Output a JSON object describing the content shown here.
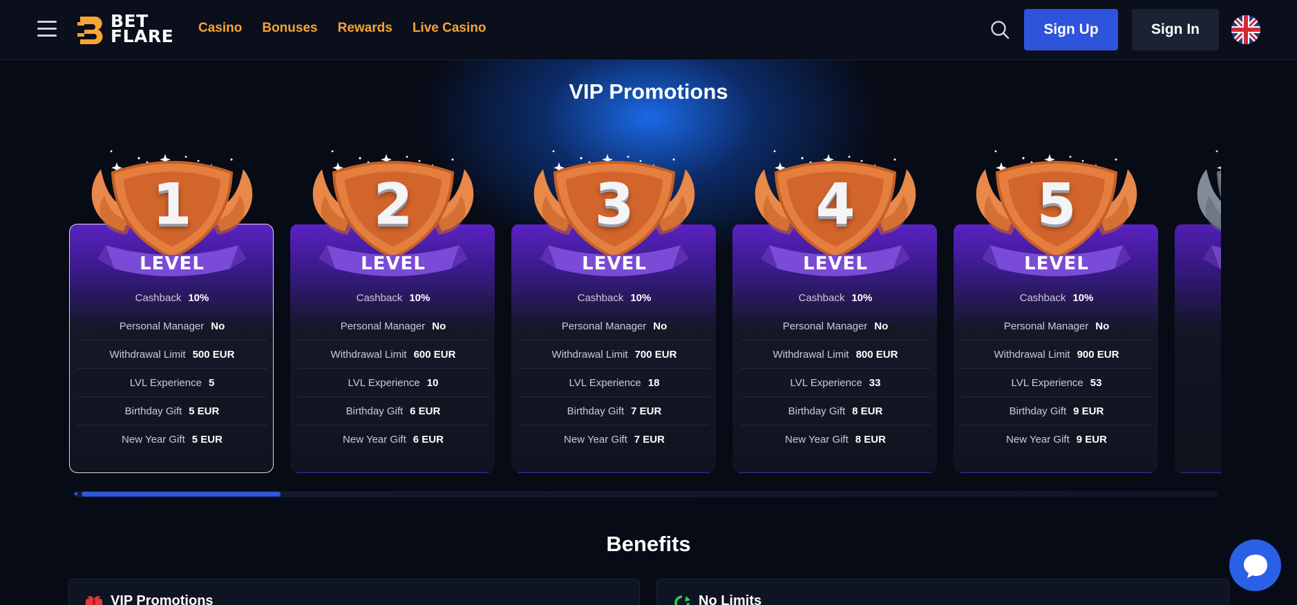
{
  "header": {
    "logo_text_line1": "BET",
    "logo_text_line2": "FLARE",
    "nav": [
      "Casino",
      "Bonuses",
      "Rewards",
      "Live Casino"
    ],
    "signup_label": "Sign Up",
    "signin_label": "Sign In"
  },
  "vip": {
    "title": "VIP Promotions",
    "badge_word": "LEVEL",
    "row_labels": [
      "Cashback",
      "Personal Manager",
      "Withdrawal Limit",
      "LVL Experience",
      "Birthday Gift",
      "New Year Gift"
    ],
    "levels": [
      {
        "number": "1",
        "cashback": "10%",
        "manager": "No",
        "withdrawal": "500 EUR",
        "experience": "5",
        "birthday": "5 EUR",
        "newyear": "5 EUR"
      },
      {
        "number": "2",
        "cashback": "10%",
        "manager": "No",
        "withdrawal": "600 EUR",
        "experience": "10",
        "birthday": "6 EUR",
        "newyear": "6 EUR"
      },
      {
        "number": "3",
        "cashback": "10%",
        "manager": "No",
        "withdrawal": "700 EUR",
        "experience": "18",
        "birthday": "7 EUR",
        "newyear": "7 EUR"
      },
      {
        "number": "4",
        "cashback": "10%",
        "manager": "No",
        "withdrawal": "800 EUR",
        "experience": "33",
        "birthday": "8 EUR",
        "newyear": "8 EUR"
      },
      {
        "number": "5",
        "cashback": "10%",
        "manager": "No",
        "withdrawal": "900 EUR",
        "experience": "53",
        "birthday": "9 EUR",
        "newyear": "9 EUR"
      }
    ]
  },
  "benefits": {
    "title": "Benefits",
    "items": [
      "VIP Promotions",
      "No Limits"
    ]
  },
  "colors": {
    "accent_orange": "#f7a532",
    "primary_blue": "#2e54dc",
    "badge_bronze": "#e47f3f",
    "ribbon_purple": "#7a4bd6"
  },
  "icons": [
    "hamburger-icon",
    "search-icon",
    "uk-flag-icon",
    "chat-icon",
    "level-badge-icon",
    "gift-icon",
    "no-limits-icon"
  ]
}
